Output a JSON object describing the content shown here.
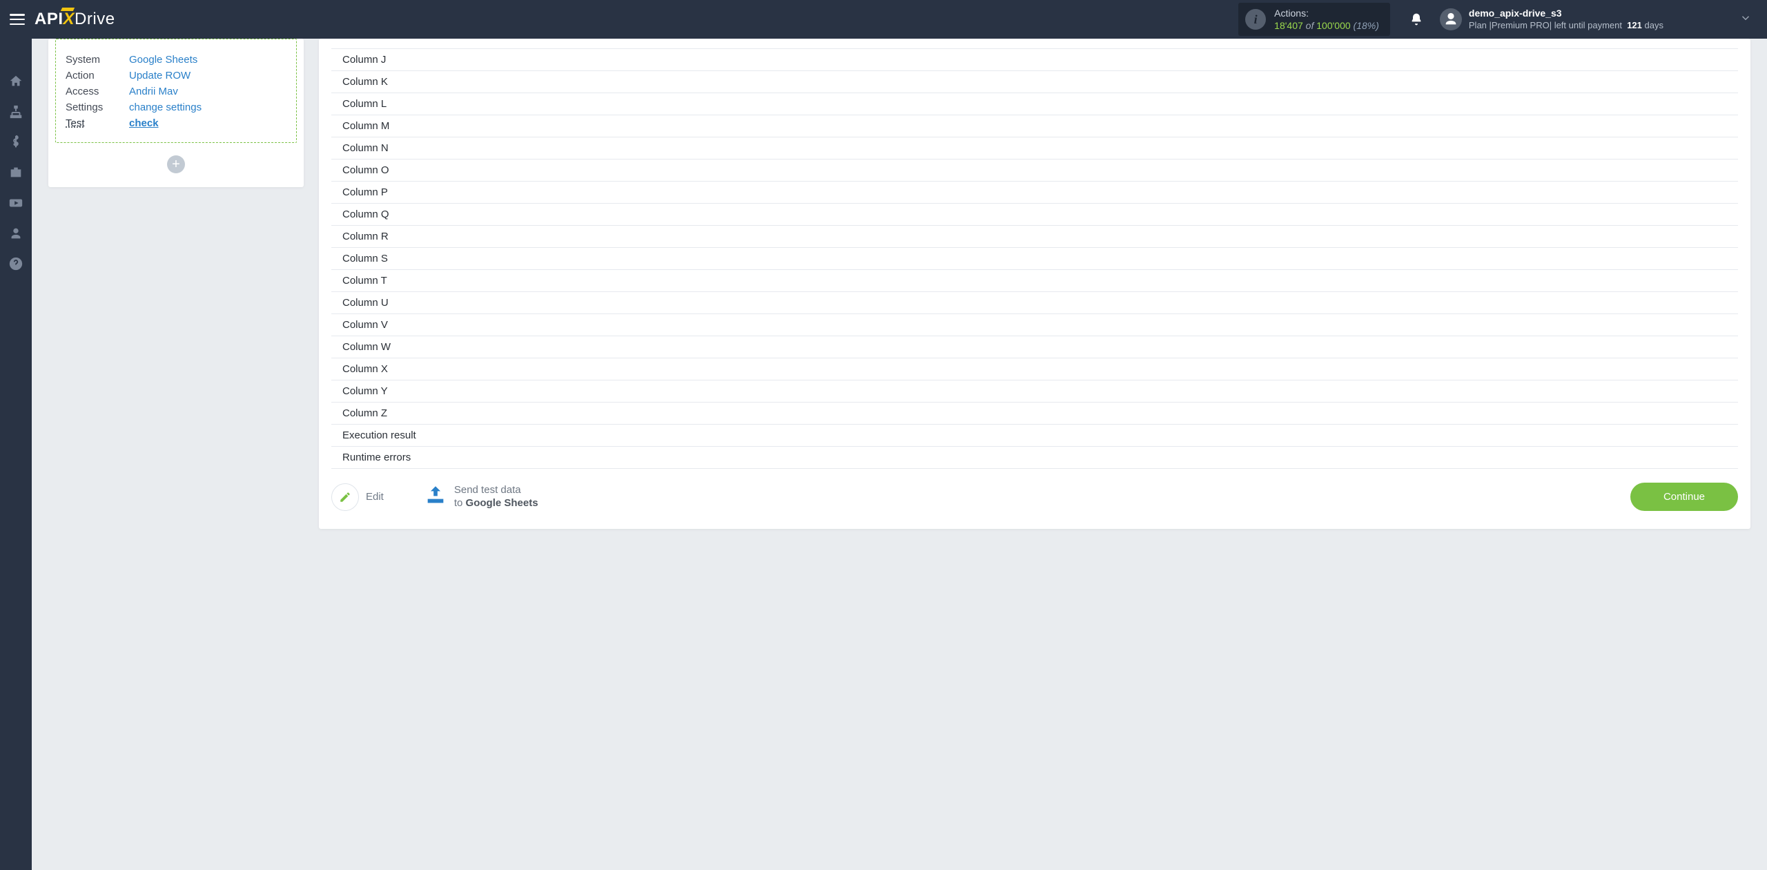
{
  "header": {
    "logo_api": "API",
    "logo_x": "X",
    "logo_drive": "Drive",
    "actions_label": "Actions:",
    "actions_used": "18'407",
    "actions_of": "of",
    "actions_total": "100'000",
    "actions_pct": "(18%)",
    "user_name": "demo_apix-drive_s3",
    "plan_prefix": "Plan |",
    "plan_name": "Premium PRO",
    "plan_mid": "| left until payment",
    "plan_days": "121",
    "plan_suffix": "days"
  },
  "config_box": {
    "rows": [
      {
        "label": "System",
        "value": "Google Sheets",
        "link": true,
        "underline": false
      },
      {
        "label": "Action",
        "value": "Update ROW",
        "link": true,
        "underline": false
      },
      {
        "label": "Access",
        "value": "Andrii Mav",
        "link": true,
        "underline": false
      },
      {
        "label": "Settings",
        "value": "change settings",
        "link": true,
        "underline": false
      },
      {
        "label": "Test",
        "value": "check",
        "link": true,
        "underline": true
      }
    ]
  },
  "columns": [
    "Column J",
    "Column K",
    "Column L",
    "Column M",
    "Column N",
    "Column O",
    "Column P",
    "Column Q",
    "Column R",
    "Column S",
    "Column T",
    "Column U",
    "Column V",
    "Column W",
    "Column X",
    "Column Y",
    "Column Z",
    "Execution result",
    "Runtime errors"
  ],
  "footer": {
    "edit_label": "Edit",
    "send_line1": "Send test data",
    "send_line2_prefix": "to ",
    "send_line2_bold": "Google Sheets",
    "continue_label": "Continue"
  }
}
